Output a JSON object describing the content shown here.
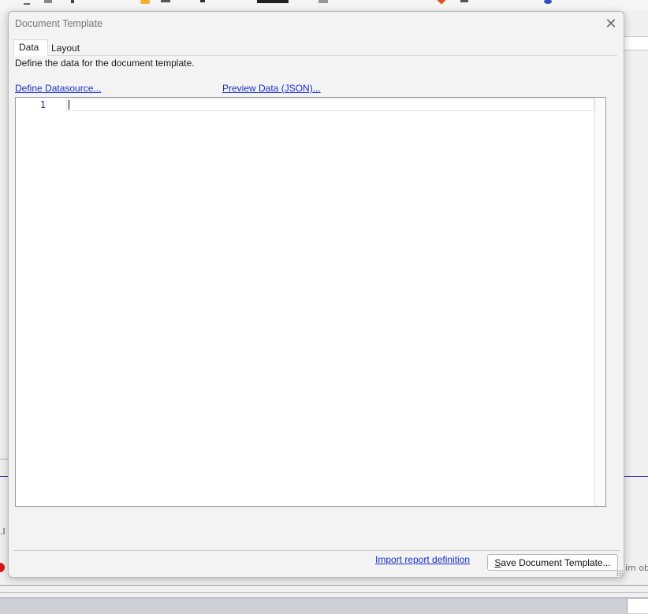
{
  "dialog": {
    "title": "Document Template",
    "close_symbol": "✕",
    "tabs": [
      {
        "label": "Data",
        "active": true
      },
      {
        "label": "Layout",
        "active": false
      }
    ],
    "description": "Define the data for the document template.",
    "links": {
      "define_datasource": "Define Datasource...",
      "preview_data": "Preview Data (JSON)...",
      "import_report": "Import report definition"
    },
    "editor": {
      "line_numbers": [
        "1"
      ],
      "content": ""
    },
    "buttons": {
      "save_prefix_mnemonic": "S",
      "save_rest": "ave Document Template..."
    }
  },
  "background": {
    "left_fragment": ".l",
    "right_fragment": "lim obj"
  },
  "colors": {
    "link": "#1a2fc8",
    "line_number": "#1f3a8a",
    "title_text": "#767676"
  }
}
